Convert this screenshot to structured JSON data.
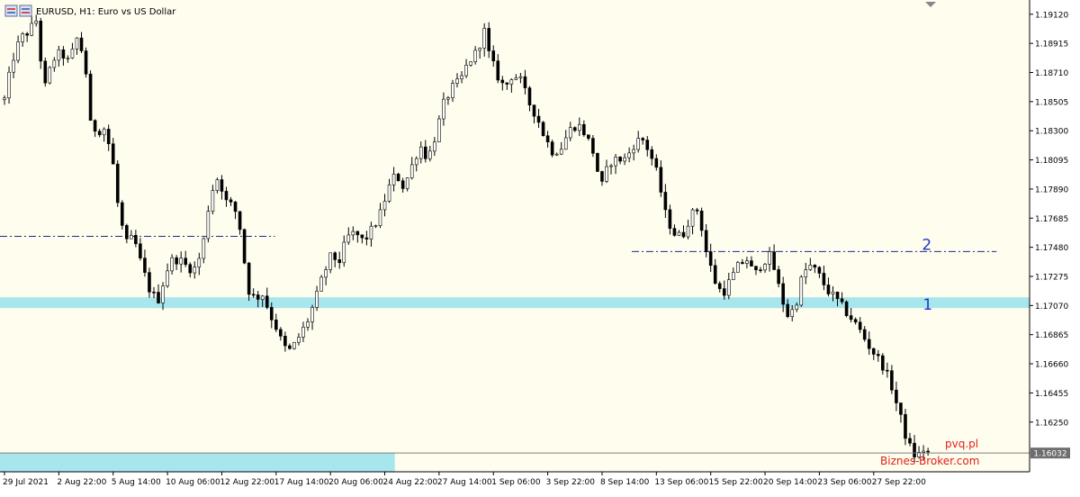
{
  "window": {
    "title": "EURUSD, H1:  Euro vs US Dollar",
    "icon": "chart-window-icon"
  },
  "colors": {
    "background": "#fefdee",
    "axis_area": "#ffffff",
    "candles": "#000000",
    "zone": "#a8e6ee",
    "level_line": "#1f2a8a",
    "price_line": "#808080",
    "annotation": "#2233cc",
    "watermark": "#e0201a",
    "price_label_bg": "#6e6e6e"
  },
  "chart_data": {
    "type": "candlestick",
    "title": "EURUSD, H1:  Euro vs US Dollar",
    "symbol": "EURUSD",
    "timeframe": "H1",
    "ylim": [
      1.159,
      1.1922
    ],
    "y_ticks": [
      "1.19120",
      "1.18915",
      "1.18710",
      "1.18505",
      "1.18300",
      "1.18095",
      "1.17890",
      "1.17685",
      "1.17480",
      "1.17275",
      "1.17070",
      "1.16865",
      "1.16660",
      "1.16455",
      "1.16250"
    ],
    "x_ticks": [
      "29 Jul 2021",
      "2 Aug 22:00",
      "5 Aug 14:00",
      "10 Aug 06:00",
      "12 Aug 22:00",
      "17 Aug 14:00",
      "20 Aug 06:00",
      "24 Aug 22:00",
      "27 Aug 14:00",
      "1 Sep 06:00",
      "3 Sep 22:00",
      "8 Sep 14:00",
      "13 Sep 06:00",
      "15 Sep 22:00",
      "20 Sep 14:00",
      "23 Sep 06:00",
      "27 Sep 22:00"
    ],
    "x_tick_index": [
      0,
      12,
      24,
      36,
      48,
      60,
      72,
      84,
      96,
      108,
      120,
      132,
      144,
      156,
      168,
      180,
      192
    ],
    "n_bars": 205,
    "current_price": "1.16032",
    "close_path": [
      [
        0,
        1.1852
      ],
      [
        2,
        1.188
      ],
      [
        4,
        1.1895
      ],
      [
        6,
        1.19
      ],
      [
        8,
        1.1908
      ],
      [
        9,
        1.188
      ],
      [
        10,
        1.186
      ],
      [
        12,
        1.188
      ],
      [
        14,
        1.1885
      ],
      [
        16,
        1.1878
      ],
      [
        18,
        1.1895
      ],
      [
        20,
        1.188
      ],
      [
        21,
        1.1835
      ],
      [
        23,
        1.183
      ],
      [
        25,
        1.1832
      ],
      [
        27,
        1.1805
      ],
      [
        28,
        1.178
      ],
      [
        29,
        1.1765
      ],
      [
        30,
        1.175
      ],
      [
        32,
        1.1755
      ],
      [
        34,
        1.1735
      ],
      [
        36,
        1.1718
      ],
      [
        38,
        1.171
      ],
      [
        39,
        1.172
      ],
      [
        41,
        1.1738
      ],
      [
        43,
        1.174
      ],
      [
        45,
        1.1735
      ],
      [
        47,
        1.1732
      ],
      [
        49,
        1.1745
      ],
      [
        51,
        1.1785
      ],
      [
        53,
        1.1798
      ],
      [
        55,
        1.178
      ],
      [
        57,
        1.1776
      ],
      [
        59,
        1.1755
      ],
      [
        60,
        1.172
      ],
      [
        62,
        1.1712
      ],
      [
        64,
        1.1715
      ],
      [
        66,
        1.17
      ],
      [
        68,
        1.1688
      ],
      [
        69,
        1.1678
      ],
      [
        71,
        1.1675
      ],
      [
        73,
        1.1685
      ],
      [
        75,
        1.1695
      ],
      [
        77,
        1.171
      ],
      [
        79,
        1.1728
      ],
      [
        81,
        1.1742
      ],
      [
        83,
        1.1738
      ],
      [
        85,
        1.1755
      ],
      [
        87,
        1.1758
      ],
      [
        89,
        1.1752
      ],
      [
        91,
        1.176
      ],
      [
        93,
        1.177
      ],
      [
        95,
        1.1788
      ],
      [
        97,
        1.18
      ],
      [
        99,
        1.179
      ],
      [
        101,
        1.1805
      ],
      [
        103,
        1.182
      ],
      [
        105,
        1.181
      ],
      [
        107,
        1.1828
      ],
      [
        109,
        1.185
      ],
      [
        111,
        1.186
      ],
      [
        113,
        1.1865
      ],
      [
        115,
        1.1878
      ],
      [
        117,
        1.1885
      ],
      [
        119,
        1.19
      ],
      [
        120,
        1.1885
      ],
      [
        122,
        1.187
      ],
      [
        124,
        1.186
      ],
      [
        126,
        1.187
      ],
      [
        128,
        1.1865
      ],
      [
        130,
        1.185
      ],
      [
        132,
        1.184
      ],
      [
        134,
        1.1825
      ],
      [
        136,
        1.1815
      ],
      [
        138,
        1.1818
      ],
      [
        140,
        1.183
      ],
      [
        142,
        1.1835
      ],
      [
        144,
        1.1828
      ],
      [
        146,
        1.1815
      ],
      [
        148,
        1.179
      ],
      [
        150,
        1.1808
      ],
      [
        152,
        1.181
      ],
      [
        154,
        1.181
      ],
      [
        156,
        1.182
      ],
      [
        158,
        1.1825
      ],
      [
        160,
        1.1815
      ],
      [
        162,
        1.1798
      ],
      [
        164,
        1.177
      ],
      [
        166,
        1.1758
      ],
      [
        168,
        1.1755
      ],
      [
        170,
        1.177
      ],
      [
        172,
        1.1775
      ],
      [
        174,
        1.1745
      ],
      [
        176,
        1.1725
      ],
      [
        178,
        1.1715
      ],
      [
        180,
        1.1725
      ],
      [
        182,
        1.1735
      ],
      [
        184,
        1.174
      ],
      [
        186,
        1.1728
      ],
      [
        188,
        1.1738
      ],
      [
        190,
        1.1742
      ],
      [
        192,
        1.172
      ],
      [
        194,
        1.17
      ],
      [
        196,
        1.1705
      ],
      [
        198,
        1.173
      ],
      [
        200,
        1.1735
      ],
      [
        202,
        1.1728
      ],
      [
        204,
        1.1718
      ],
      [
        206,
        1.1712
      ],
      [
        208,
        1.1705
      ],
      [
        210,
        1.1698
      ],
      [
        212,
        1.169
      ],
      [
        214,
        1.168
      ],
      [
        216,
        1.1672
      ],
      [
        218,
        1.1664
      ],
      [
        220,
        1.165
      ],
      [
        222,
        1.163
      ],
      [
        224,
        1.161
      ],
      [
        226,
        1.16
      ],
      [
        228,
        1.1606
      ],
      [
        229,
        1.1603
      ]
    ],
    "zones": [
      {
        "name": "zone-1",
        "price_from": 1.17052,
        "price_to": 1.17128,
        "x_from": 0,
        "x_to": 1.0
      },
      {
        "name": "zone-bottom",
        "price_from": 1.159,
        "price_to": 1.1603,
        "x_from": 0,
        "x_to": 0.3835
      }
    ],
    "levels": [
      {
        "name": "level-a",
        "price": 1.17557,
        "x_from": 0,
        "x_to": 0.267
      },
      {
        "name": "level-b",
        "price": 1.1745,
        "x_from": 0.6136,
        "x_to": 0.9679
      }
    ],
    "annotations": [
      {
        "text": "2",
        "price": 1.175,
        "x_frac": 0.8954
      },
      {
        "text": "1",
        "price": 1.1708,
        "x_frac": 0.8963
      }
    ],
    "watermark": [
      "pvq.pl",
      "Biznes-Broker.com"
    ]
  }
}
